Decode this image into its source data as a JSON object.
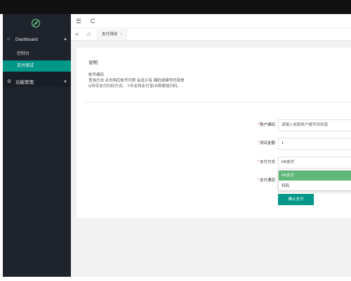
{
  "sidebar": {
    "logo_icon": "leaf-logo-icon",
    "dashboard": {
      "label": "Dashboard",
      "icon": "home-icon",
      "arrow": "▲"
    },
    "items": [
      {
        "label": "控制台"
      },
      {
        "label": "支付测试"
      }
    ],
    "function_mgmt": {
      "label": "功能管理",
      "icon": "gear-icon",
      "arrow": "▼"
    }
  },
  "toolbar": {
    "menu_toggle": "☰",
    "refresh": "C"
  },
  "tabs": {
    "back": "«",
    "home": "⌂",
    "active_tab": "支付测试",
    "close": "×"
  },
  "note": {
    "title": "说明",
    "lines": [
      "帐号编码",
      "查询方法 点击相应帐号列表 会显示有 编码或编号的就是",
      "Q币仅支付扫码方式。 Y币支持支付宝H5和微信扫码。"
    ]
  },
  "form": {
    "account_code": {
      "label": "账户编码",
      "placeholder": "请输入收款账户编号到如南"
    },
    "amount": {
      "label": "测试金额",
      "value": "1"
    },
    "pay_method": {
      "label": "支付方式",
      "value": "H5支付"
    },
    "channel": {
      "label": "支付通道"
    },
    "options": [
      "H5支付",
      "扫码"
    ],
    "submit": "确认支付"
  },
  "colors": {
    "accent": "#009688",
    "sidebar": "#1f232c",
    "option_highlight": "#5fb878"
  }
}
